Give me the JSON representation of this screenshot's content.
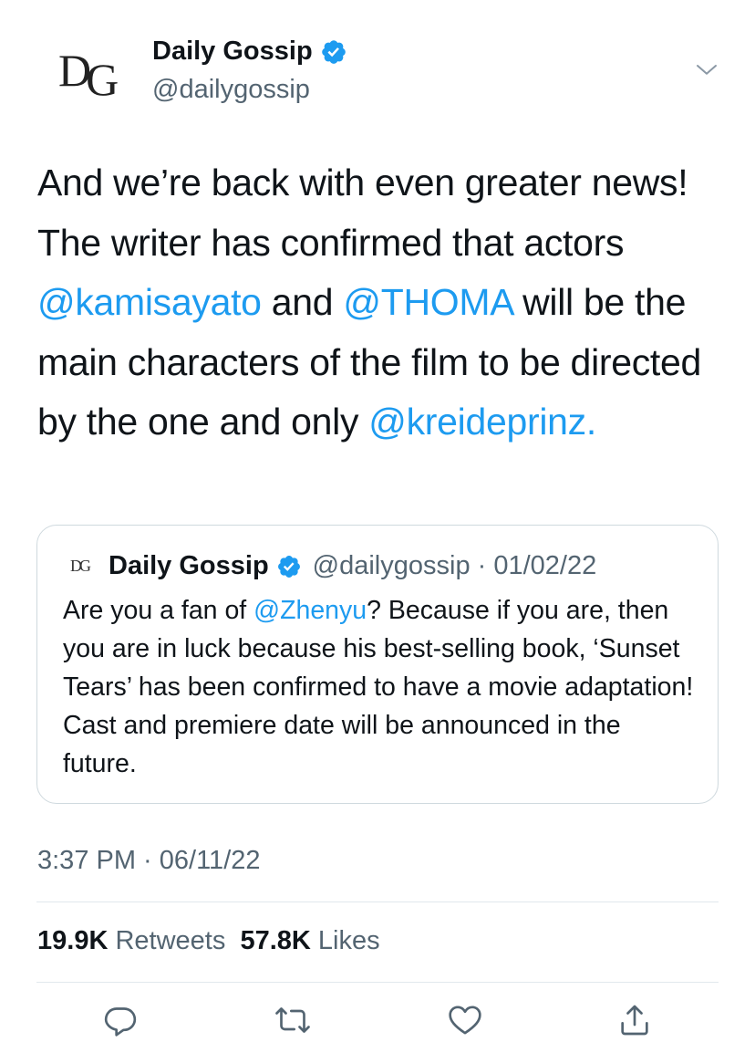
{
  "tweet": {
    "author": {
      "name": "Daily Gossip",
      "handle": "@dailygossip",
      "avatar_monogram": "DG",
      "avatar_subtext": "Daily Gossip",
      "verified": true
    },
    "text_parts": [
      "And we’re back with even greater news! The writer has confirmed that actors ",
      "@kamisayato",
      " and ",
      "@THOMA",
      " will be the main characters of the film to be directed by the one and only ",
      "@kreideprinz."
    ],
    "timestamp": "3:37 PM · 06/11/22",
    "stats": {
      "retweets_count": "19.9K",
      "retweets_label": "Retweets",
      "likes_count": "57.8K",
      "likes_label": "Likes"
    }
  },
  "quoted_tweet": {
    "avatar_monogram": "DG",
    "name": "Daily Gossip",
    "handle_date": "@dailygossip · 01/02/22",
    "text_parts": [
      "Are you a fan of ",
      "@Zhenyu",
      "? Because if you are, then you are in luck because his best-selling book, ‘Sunset Tears’ has been confirmed to have a movie adaptation! Cast and premiere date will be announced in the future."
    ]
  },
  "icons": {
    "verified": "verified-badge-icon",
    "caret": "chevron-down-icon",
    "reply": "reply-icon",
    "retweet": "retweet-icon",
    "like": "heart-icon",
    "share": "share-icon"
  },
  "colors": {
    "accent": "#1d9bf0",
    "text": "#0f1419",
    "secondary": "#536471",
    "border": "#cfd9de"
  }
}
